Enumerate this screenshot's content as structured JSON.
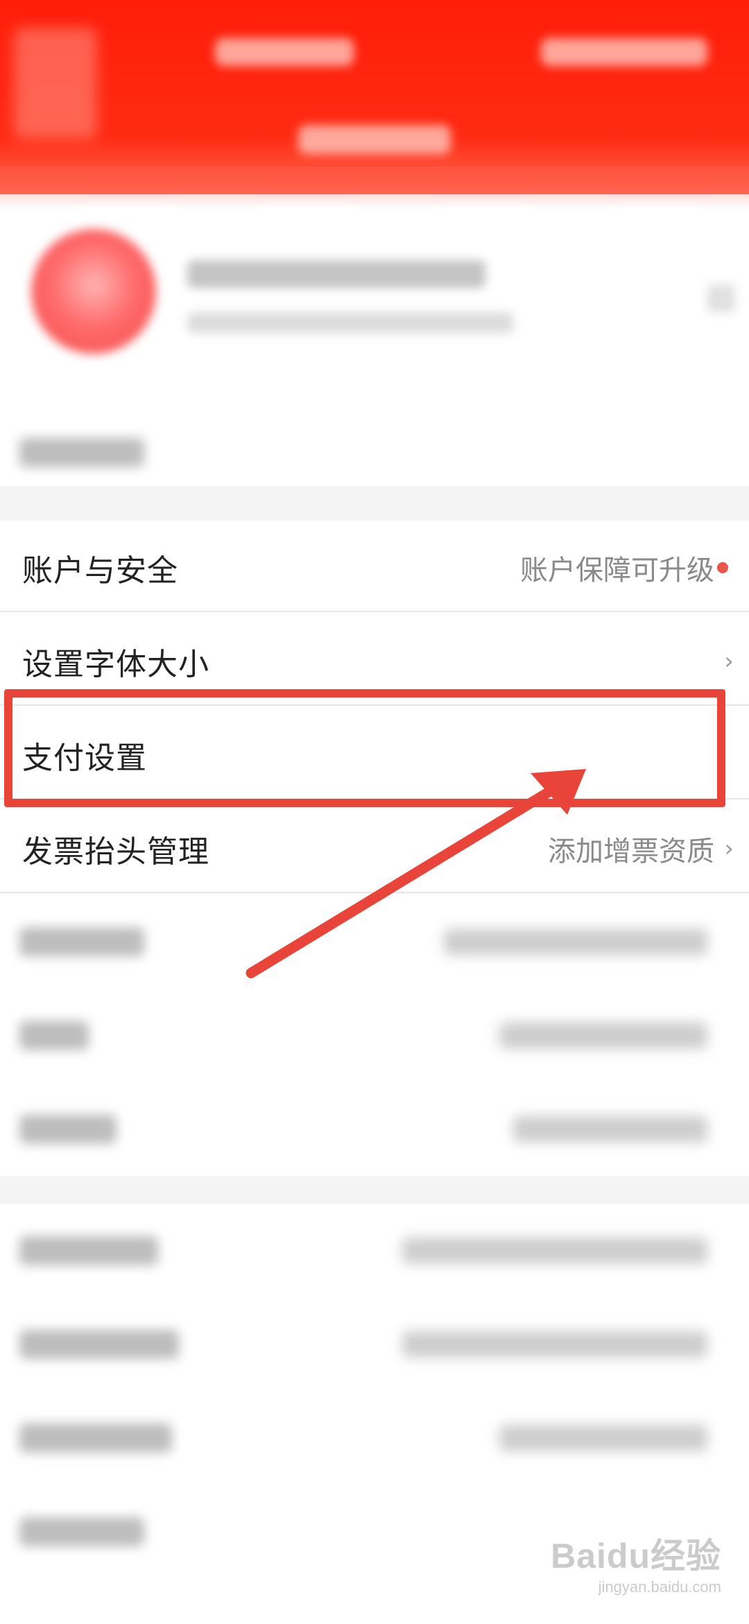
{
  "settings": {
    "rows": [
      {
        "label": "账户与安全",
        "hint": "账户保障可升级"
      },
      {
        "label": "设置字体大小",
        "hint": ""
      },
      {
        "label": "支付设置",
        "hint": ""
      },
      {
        "label": "发票抬头管理",
        "hint": "添加增票资质"
      }
    ],
    "chevron": "›"
  },
  "annotation": {
    "color": "#e8443a",
    "highlighted_row": "支付设置"
  },
  "watermark": {
    "main": "Baidu经验",
    "sub": "jingyan.baidu.com"
  },
  "colors": {
    "header": "#ff1e0a",
    "accent_dot": "#e8554a"
  },
  "icons": {
    "chevron": "chevron-right-icon"
  }
}
